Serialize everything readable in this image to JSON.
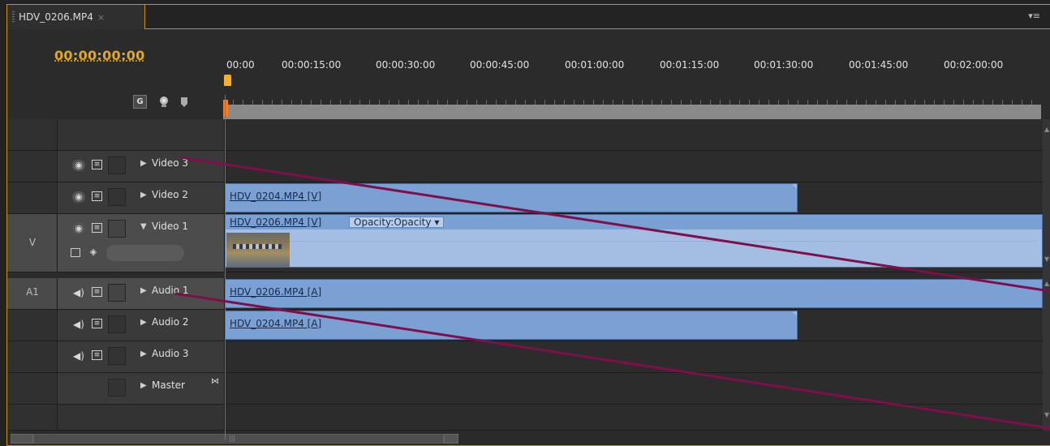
{
  "tab": {
    "label": "HDV_0206.MP4",
    "close": "×"
  },
  "panel_menu": "▾≡",
  "timecode": "00:00:00:00",
  "ruler_labels": [
    "00:00",
    "00:00:15:00",
    "00:00:30:00",
    "00:00:45:00",
    "00:01:00:00",
    "00:01:15:00",
    "00:01:30:00",
    "00:01:45:00",
    "00:02:00:00"
  ],
  "tools": {
    "snap": "snap-icon",
    "marker_light": "lightbulb-icon",
    "add_marker": "marker-icon"
  },
  "tracks": {
    "video3": {
      "name": "Video 3"
    },
    "video2": {
      "name": "Video 2",
      "clip": "HDV_0204.MP4",
      "clip_suffix": " [V]"
    },
    "video1": {
      "target": "V",
      "name": "Video 1",
      "clip": "HDV_0206.MP4",
      "clip_suffix": " [V]",
      "opacity": "Opacity:Opacity"
    },
    "audio1": {
      "target": "A1",
      "name": "Audio 1",
      "clip": "HDV_0206.MP4",
      "clip_suffix": " [A]"
    },
    "audio2": {
      "name": "Audio 2",
      "clip": "HDV_0204.MP4",
      "clip_suffix": " [A]"
    },
    "audio3": {
      "name": "Audio 3"
    },
    "master": {
      "name": "Master"
    }
  },
  "colors": {
    "accent": "#c98f1a",
    "timecode": "#e0a824",
    "clip": "#7aa0d4",
    "annotation": "#7d0f4a"
  }
}
